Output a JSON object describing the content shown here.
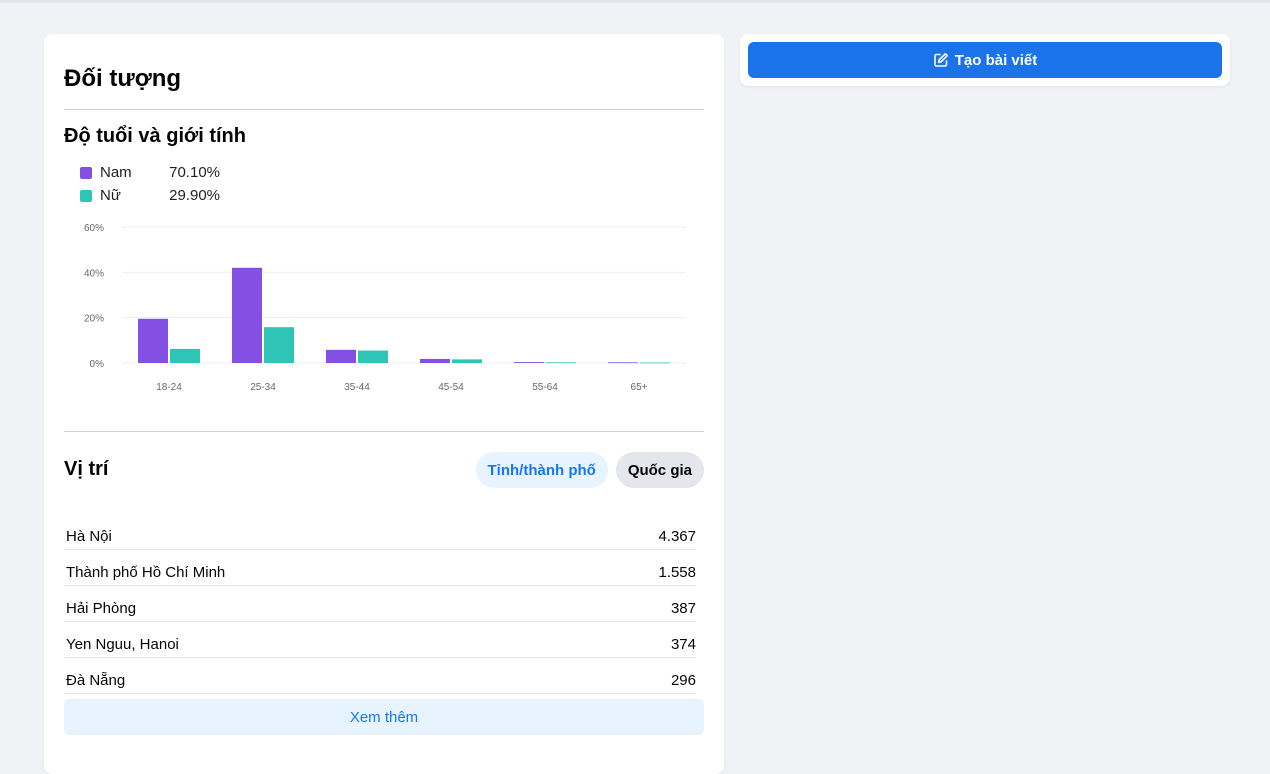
{
  "audience": {
    "title": "Đối tượng",
    "age_gender": {
      "title": "Độ tuổi và giới tính",
      "legend": [
        {
          "label": "Nam",
          "value": "70.10%",
          "color": "#8450e3"
        },
        {
          "label": "Nữ",
          "value": "29.90%",
          "color": "#2ec4b6"
        }
      ]
    },
    "location": {
      "title": "Vị trí",
      "tabs": [
        {
          "label": "Tỉnh/thành phố",
          "active": true
        },
        {
          "label": "Quốc gia",
          "active": false
        }
      ],
      "rows": [
        {
          "name": "Hà Nội",
          "value": "4.367"
        },
        {
          "name": "Thành phố Hồ Chí Minh",
          "value": "1.558"
        },
        {
          "name": "Hải Phòng",
          "value": "387"
        },
        {
          "name": "Yen Nguu, Hanoi",
          "value": "374"
        },
        {
          "name": "Đà Nẵng",
          "value": "296"
        }
      ],
      "more_label": "Xem thêm"
    }
  },
  "create_post": {
    "label": "Tạo bài viết",
    "icon": "edit-icon"
  },
  "chart_data": {
    "type": "bar",
    "categories": [
      "18-24",
      "25-34",
      "35-44",
      "45-54",
      "55-64",
      "65+"
    ],
    "series": [
      {
        "name": "Nam",
        "values": [
          19.5,
          42,
          5.8,
          1.8,
          0.4,
          0.3
        ],
        "color": "#8450e3"
      },
      {
        "name": "Nữ",
        "values": [
          6.2,
          15.8,
          5.5,
          1.6,
          0.3,
          0.2
        ],
        "color": "#2ec4b6"
      }
    ],
    "yticks": [
      "0%",
      "20%",
      "40%",
      "60%"
    ],
    "ylim": [
      0,
      60
    ],
    "grid": true,
    "legend": "top-left"
  }
}
